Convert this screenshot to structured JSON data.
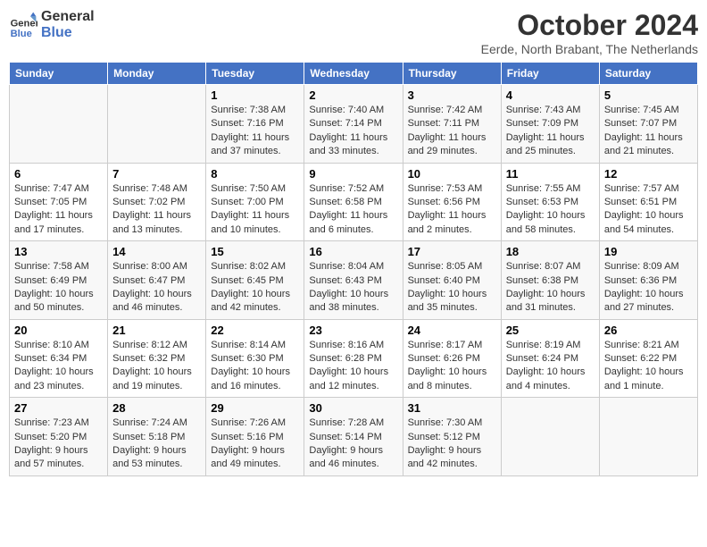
{
  "header": {
    "logo_line1": "General",
    "logo_line2": "Blue",
    "month_title": "October 2024",
    "location": "Eerde, North Brabant, The Netherlands"
  },
  "days_of_week": [
    "Sunday",
    "Monday",
    "Tuesday",
    "Wednesday",
    "Thursday",
    "Friday",
    "Saturday"
  ],
  "weeks": [
    [
      {
        "day": "",
        "info": ""
      },
      {
        "day": "",
        "info": ""
      },
      {
        "day": "1",
        "info": "Sunrise: 7:38 AM\nSunset: 7:16 PM\nDaylight: 11 hours and 37 minutes."
      },
      {
        "day": "2",
        "info": "Sunrise: 7:40 AM\nSunset: 7:14 PM\nDaylight: 11 hours and 33 minutes."
      },
      {
        "day": "3",
        "info": "Sunrise: 7:42 AM\nSunset: 7:11 PM\nDaylight: 11 hours and 29 minutes."
      },
      {
        "day": "4",
        "info": "Sunrise: 7:43 AM\nSunset: 7:09 PM\nDaylight: 11 hours and 25 minutes."
      },
      {
        "day": "5",
        "info": "Sunrise: 7:45 AM\nSunset: 7:07 PM\nDaylight: 11 hours and 21 minutes."
      }
    ],
    [
      {
        "day": "6",
        "info": "Sunrise: 7:47 AM\nSunset: 7:05 PM\nDaylight: 11 hours and 17 minutes."
      },
      {
        "day": "7",
        "info": "Sunrise: 7:48 AM\nSunset: 7:02 PM\nDaylight: 11 hours and 13 minutes."
      },
      {
        "day": "8",
        "info": "Sunrise: 7:50 AM\nSunset: 7:00 PM\nDaylight: 11 hours and 10 minutes."
      },
      {
        "day": "9",
        "info": "Sunrise: 7:52 AM\nSunset: 6:58 PM\nDaylight: 11 hours and 6 minutes."
      },
      {
        "day": "10",
        "info": "Sunrise: 7:53 AM\nSunset: 6:56 PM\nDaylight: 11 hours and 2 minutes."
      },
      {
        "day": "11",
        "info": "Sunrise: 7:55 AM\nSunset: 6:53 PM\nDaylight: 10 hours and 58 minutes."
      },
      {
        "day": "12",
        "info": "Sunrise: 7:57 AM\nSunset: 6:51 PM\nDaylight: 10 hours and 54 minutes."
      }
    ],
    [
      {
        "day": "13",
        "info": "Sunrise: 7:58 AM\nSunset: 6:49 PM\nDaylight: 10 hours and 50 minutes."
      },
      {
        "day": "14",
        "info": "Sunrise: 8:00 AM\nSunset: 6:47 PM\nDaylight: 10 hours and 46 minutes."
      },
      {
        "day": "15",
        "info": "Sunrise: 8:02 AM\nSunset: 6:45 PM\nDaylight: 10 hours and 42 minutes."
      },
      {
        "day": "16",
        "info": "Sunrise: 8:04 AM\nSunset: 6:43 PM\nDaylight: 10 hours and 38 minutes."
      },
      {
        "day": "17",
        "info": "Sunrise: 8:05 AM\nSunset: 6:40 PM\nDaylight: 10 hours and 35 minutes."
      },
      {
        "day": "18",
        "info": "Sunrise: 8:07 AM\nSunset: 6:38 PM\nDaylight: 10 hours and 31 minutes."
      },
      {
        "day": "19",
        "info": "Sunrise: 8:09 AM\nSunset: 6:36 PM\nDaylight: 10 hours and 27 minutes."
      }
    ],
    [
      {
        "day": "20",
        "info": "Sunrise: 8:10 AM\nSunset: 6:34 PM\nDaylight: 10 hours and 23 minutes."
      },
      {
        "day": "21",
        "info": "Sunrise: 8:12 AM\nSunset: 6:32 PM\nDaylight: 10 hours and 19 minutes."
      },
      {
        "day": "22",
        "info": "Sunrise: 8:14 AM\nSunset: 6:30 PM\nDaylight: 10 hours and 16 minutes."
      },
      {
        "day": "23",
        "info": "Sunrise: 8:16 AM\nSunset: 6:28 PM\nDaylight: 10 hours and 12 minutes."
      },
      {
        "day": "24",
        "info": "Sunrise: 8:17 AM\nSunset: 6:26 PM\nDaylight: 10 hours and 8 minutes."
      },
      {
        "day": "25",
        "info": "Sunrise: 8:19 AM\nSunset: 6:24 PM\nDaylight: 10 hours and 4 minutes."
      },
      {
        "day": "26",
        "info": "Sunrise: 8:21 AM\nSunset: 6:22 PM\nDaylight: 10 hours and 1 minute."
      }
    ],
    [
      {
        "day": "27",
        "info": "Sunrise: 7:23 AM\nSunset: 5:20 PM\nDaylight: 9 hours and 57 minutes."
      },
      {
        "day": "28",
        "info": "Sunrise: 7:24 AM\nSunset: 5:18 PM\nDaylight: 9 hours and 53 minutes."
      },
      {
        "day": "29",
        "info": "Sunrise: 7:26 AM\nSunset: 5:16 PM\nDaylight: 9 hours and 49 minutes."
      },
      {
        "day": "30",
        "info": "Sunrise: 7:28 AM\nSunset: 5:14 PM\nDaylight: 9 hours and 46 minutes."
      },
      {
        "day": "31",
        "info": "Sunrise: 7:30 AM\nSunset: 5:12 PM\nDaylight: 9 hours and 42 minutes."
      },
      {
        "day": "",
        "info": ""
      },
      {
        "day": "",
        "info": ""
      }
    ]
  ]
}
